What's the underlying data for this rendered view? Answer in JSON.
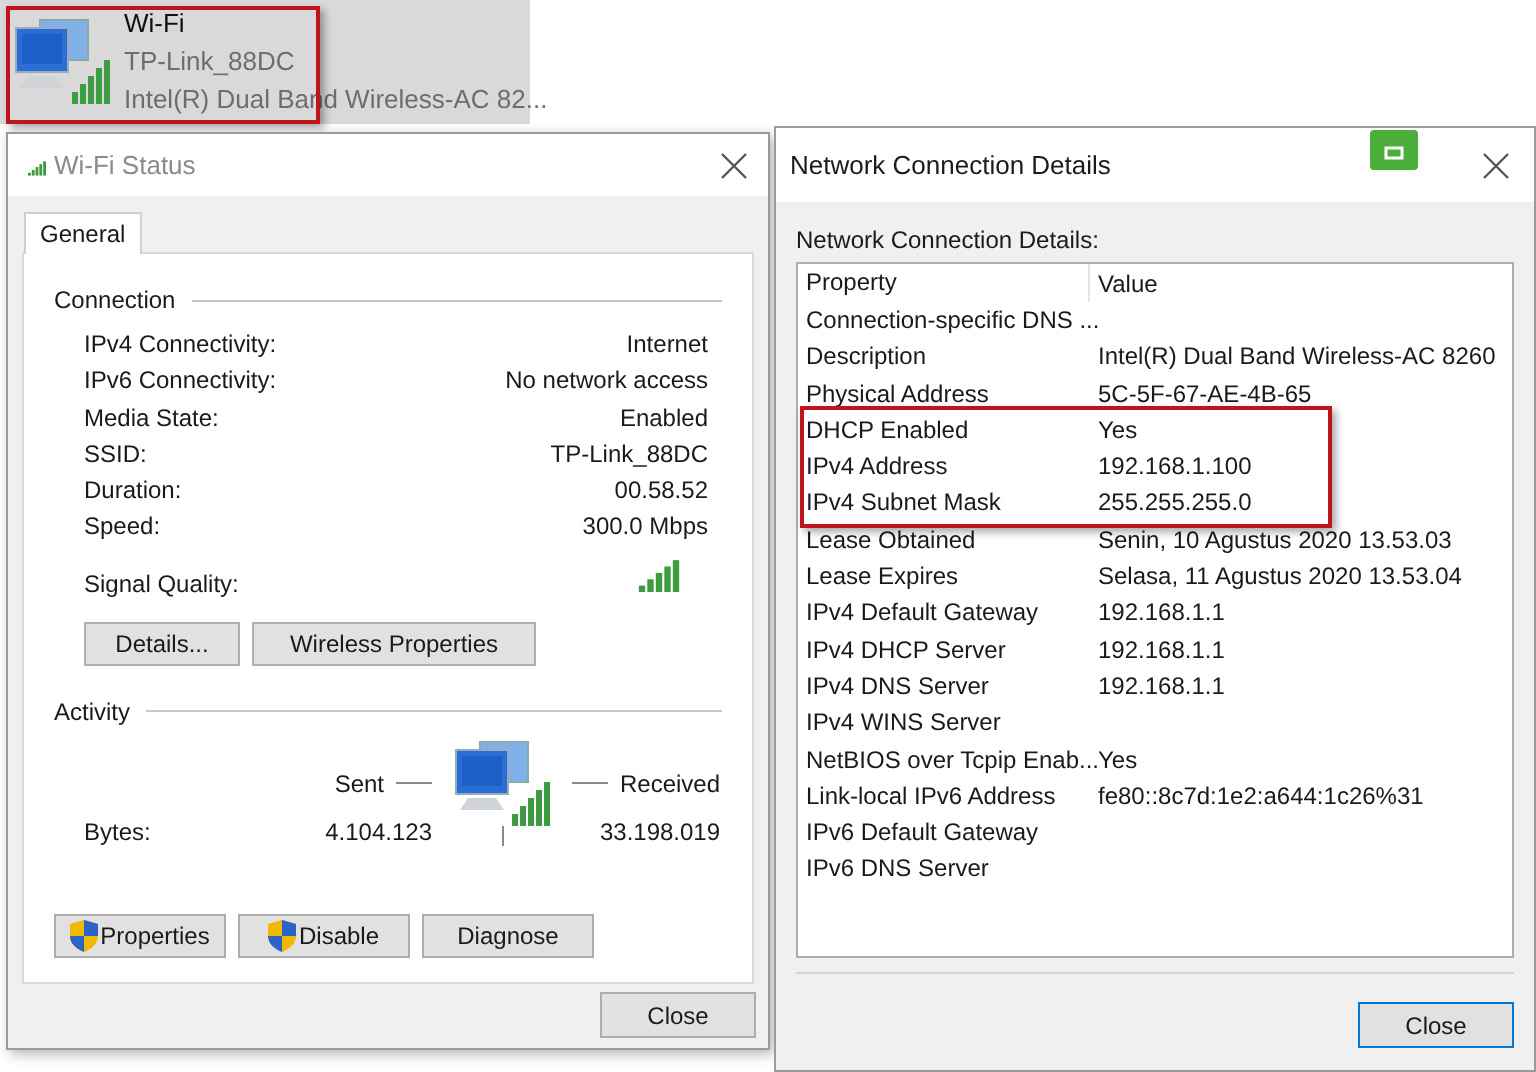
{
  "adapter": {
    "name": "Wi-Fi",
    "network": "TP-Link_88DC",
    "device": "Intel(R) Dual Band Wireless-AC 82...",
    "highlighted": true
  },
  "status_window": {
    "title": "Wi-Fi Status",
    "tabs": [
      {
        "label": "General",
        "selected": true
      }
    ],
    "connection": {
      "heading": "Connection",
      "fields": [
        {
          "label": "IPv4 Connectivity:",
          "value": "Internet"
        },
        {
          "label": "IPv6 Connectivity:",
          "value": "No network access"
        },
        {
          "label": "Media State:",
          "value": "Enabled"
        },
        {
          "label": "SSID:",
          "value": "TP-Link_88DC"
        },
        {
          "label": "Duration:",
          "value": "00.58.52"
        },
        {
          "label": "Speed:",
          "value": "300.0 Mbps"
        }
      ],
      "signal_label": "Signal Quality:",
      "buttons": [
        "Details...",
        "Wireless Properties"
      ]
    },
    "activity": {
      "heading": "Activity",
      "sent_label": "Sent",
      "received_label": "Received",
      "bytes_label": "Bytes:",
      "sent": "4.104.123",
      "received": "33.198.019"
    },
    "action_buttons": [
      {
        "label": "Properties",
        "shield": true
      },
      {
        "label": "Disable",
        "shield": true
      },
      {
        "label": "Diagnose",
        "shield": false
      }
    ],
    "close_button": "Close"
  },
  "details_window": {
    "title": "Network Connection Details",
    "label": "Network Connection Details:",
    "columns": [
      "Property",
      "Value"
    ],
    "rows": [
      {
        "property": "Connection-specific DNS ...",
        "value": "",
        "highlighted": false
      },
      {
        "property": "Description",
        "value": "Intel(R) Dual Band Wireless-AC 8260",
        "highlighted": false
      },
      {
        "property": "Physical Address",
        "value": "5C-5F-67-AE-4B-65",
        "highlighted": false
      },
      {
        "property": "DHCP Enabled",
        "value": "Yes",
        "highlighted": true
      },
      {
        "property": "IPv4 Address",
        "value": "192.168.1.100",
        "highlighted": true
      },
      {
        "property": "IPv4 Subnet Mask",
        "value": "255.255.255.0",
        "highlighted": true
      },
      {
        "property": "Lease Obtained",
        "value": "Senin, 10 Agustus 2020 13.53.03",
        "highlighted": false
      },
      {
        "property": "Lease Expires",
        "value": "Selasa, 11 Agustus 2020 13.53.04",
        "highlighted": false
      },
      {
        "property": "IPv4 Default Gateway",
        "value": "192.168.1.1",
        "highlighted": false
      },
      {
        "property": "IPv4 DHCP Server",
        "value": "192.168.1.1",
        "highlighted": false
      },
      {
        "property": "IPv4 DNS Server",
        "value": "192.168.1.1",
        "highlighted": false
      },
      {
        "property": "IPv4 WINS Server",
        "value": "",
        "highlighted": false
      },
      {
        "property": "NetBIOS over Tcpip Enab...",
        "value": "Yes",
        "highlighted": false
      },
      {
        "property": "Link-local IPv6 Address",
        "value": "fe80::8c7d:1e2:a644:1c26%31",
        "highlighted": false
      },
      {
        "property": "IPv6 Default Gateway",
        "value": "",
        "highlighted": false
      },
      {
        "property": "IPv6 DNS Server",
        "value": "",
        "highlighted": false
      }
    ],
    "close_button": "Close"
  }
}
